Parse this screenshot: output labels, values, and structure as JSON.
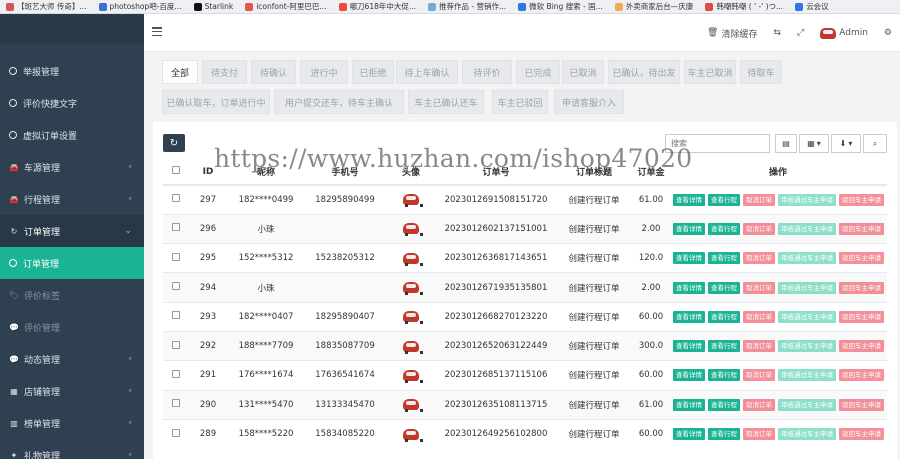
{
  "bookmarks": [
    {
      "label": "【斑艺大师 传奇】...",
      "color": "#d9534f"
    },
    {
      "label": "photoshop吧-百度...",
      "color": "#3a6fd8"
    },
    {
      "label": "Starlink",
      "color": "#111111"
    },
    {
      "label": "iconfont-阿里巴巴...",
      "color": "#e8554e"
    },
    {
      "label": "哪刀618年中大促...",
      "color": "#e74c3c"
    },
    {
      "label": "推荐作品 - 营销作...",
      "color": "#7aa6d6"
    },
    {
      "label": "微软 Bing 搜索 - 国...",
      "color": "#2a7ae2"
    },
    {
      "label": "外卖商家后台—庆康",
      "color": "#f0ad4e"
    },
    {
      "label": "韩嘲韩嘲 (  ' -' )つ...",
      "color": "#e04b4b"
    },
    {
      "label": "云会议",
      "color": "#2a7ae2"
    }
  ],
  "sidebar": {
    "items": [
      {
        "label": "举报管理",
        "icon": "circle-icon"
      },
      {
        "label": "评价快捷文字",
        "icon": "circle-icon"
      },
      {
        "label": "虚拟订单设置",
        "icon": "circle-icon"
      },
      {
        "label": "车源管理",
        "icon": "car-icon"
      },
      {
        "label": "行程管理",
        "icon": "car-icon"
      },
      {
        "label": "订单管理",
        "icon": "refresh-icon"
      },
      {
        "label": "订单管理",
        "icon": "circle-icon"
      },
      {
        "label": "评价标签",
        "icon": "tag-icon"
      },
      {
        "label": "评价管理",
        "icon": "comment-icon"
      },
      {
        "label": "动态管理",
        "icon": "comments-icon"
      },
      {
        "label": "店铺管理",
        "icon": "store-icon"
      },
      {
        "label": "榜单管理",
        "icon": "chart-icon"
      },
      {
        "label": "礼物管理",
        "icon": "gift-icon"
      }
    ]
  },
  "topbar": {
    "clear_cache": "清除缓存",
    "admin": "Admin"
  },
  "tabs": [
    "全部",
    "待支付",
    "待确认",
    "进行中",
    "已拒绝",
    "待上车确认",
    "待评价",
    "已完成",
    "已取消",
    "已确认，待出发",
    "车主已取消",
    "待取车",
    "已确认取车，订单进行中",
    "用户提交还车，待车主确认",
    "车主已确认还车",
    "车主已驳回",
    "申请客服介入"
  ],
  "toolbar": {
    "search_placeholder": "搜索"
  },
  "table": {
    "headers": [
      "ID",
      "昵称",
      "手机号",
      "头像",
      "订单号",
      "订单标题",
      "订单金",
      "操作"
    ],
    "rows": [
      {
        "id": "297",
        "nickname": "182****0499",
        "phone": "18295890499",
        "order_no": "2023012691508151720",
        "title": "创建行程订单",
        "amount": "61.00"
      },
      {
        "id": "296",
        "nickname": "小珠",
        "phone": "",
        "order_no": "2023012602137151001",
        "title": "创建行程订单",
        "amount": "2.00"
      },
      {
        "id": "295",
        "nickname": "152****5312",
        "phone": "15238205312",
        "order_no": "2023012636817143651",
        "title": "创建行程订单",
        "amount": "120.0"
      },
      {
        "id": "294",
        "nickname": "小珠",
        "phone": "",
        "order_no": "2023012671935135801",
        "title": "创建行程订单",
        "amount": "2.00"
      },
      {
        "id": "293",
        "nickname": "182****0407",
        "phone": "18295890407",
        "order_no": "2023012668270123220",
        "title": "创建行程订单",
        "amount": "60.00"
      },
      {
        "id": "292",
        "nickname": "188****7709",
        "phone": "18835087709",
        "order_no": "2023012652063122449",
        "title": "创建行程订单",
        "amount": "300.0"
      },
      {
        "id": "291",
        "nickname": "176****1674",
        "phone": "17636541674",
        "order_no": "2023012685137115106",
        "title": "创建行程订单",
        "amount": "60.00"
      },
      {
        "id": "290",
        "nickname": "131****5470",
        "phone": "13133345470",
        "order_no": "2023012635108113715",
        "title": "创建行程订单",
        "amount": "61.00"
      },
      {
        "id": "289",
        "nickname": "158****5220",
        "phone": "15834085220",
        "order_no": "2023012649256102800",
        "title": "创建行程订单",
        "amount": "60.00"
      }
    ],
    "actions": [
      "查看详情",
      "查看行程",
      "取消订单",
      "审核通过车主申请",
      "驳回车主申请"
    ]
  },
  "watermark": "https://www.huzhan.com/ishop47020"
}
